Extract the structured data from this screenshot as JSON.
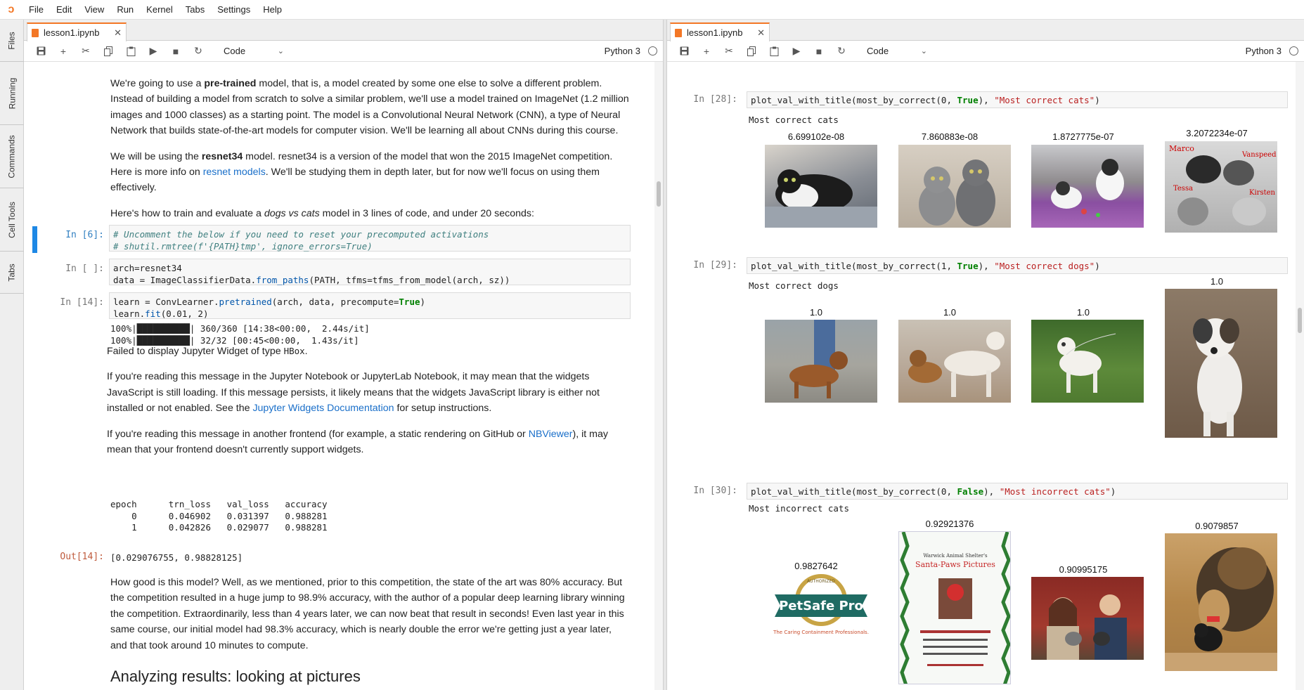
{
  "menubar": {
    "items": [
      "File",
      "Edit",
      "View",
      "Run",
      "Kernel",
      "Tabs",
      "Settings",
      "Help"
    ]
  },
  "sidebar": {
    "tabs": [
      "Files",
      "Running",
      "Commands",
      "Cell Tools",
      "Tabs"
    ]
  },
  "left": {
    "tab_title": "lesson1.ipynb",
    "cell_type": "Code",
    "kernel": "Python 3",
    "md1": {
      "p1_a": "We're going to use a ",
      "p1_b": "pre-trained",
      "p1_c": " model, that is, a model created by some one else to solve a different problem. Instead of building a model from scratch to solve a similar problem, we'll use a model trained on ImageNet (1.2 million images and 1000 classes) as a starting point. The model is a Convolutional Neural Network (CNN), a type of Neural Network that builds state-of-the-art models for computer vision. We'll be learning all about CNNs during this course.",
      "p2_a": "We will be using the ",
      "p2_b": "resnet34",
      "p2_c": " model. resnet34 is a version of the model that won the 2015 ImageNet competition. Here is more info on ",
      "p2_link": "resnet models",
      "p2_d": ". We'll be studying them in depth later, but for now we'll focus on using them effectively.",
      "p3_a": "Here's how to train and evaluate a ",
      "p3_b": "dogs vs cats",
      "p3_c": " model in 3 lines of code, and under 20 seconds:"
    },
    "cell6": {
      "prompt": "In [6]:",
      "line1": "# Uncomment the below if you need to reset your precomputed activations",
      "line2": "# shutil.rmtree(f'{PATH}tmp', ignore_errors=True)"
    },
    "cell_empty": {
      "prompt": "In [ ]:",
      "line1": "arch=resnet34",
      "line2_a": "data = ImageClassifierData.",
      "line2_fn": "from_paths",
      "line2_b": "(PATH, tfms=tfms_from_model(arch, sz))"
    },
    "cell14": {
      "prompt": "In [14]:",
      "line1_a": "learn = ConvLearner.",
      "line1_fn": "pretrained",
      "line1_b": "(arch, data, precompute=",
      "line1_kw": "True",
      "line1_c": ")",
      "line2_a": "learn.",
      "line2_fn": "fit",
      "line2_b": "(0.01, 2)",
      "progress1": "100%|██████████| 360/360 [14:38<00:00,  2.44s/it]",
      "progress2": "100%|██████████| 32/32 [00:45<00:00,  1.43s/it]",
      "widget_fail_a": "Failed to display Jupyter Widget of type ",
      "widget_fail_b": "HBox",
      "widget_fail_c": ".",
      "widget_p1_a": "If you're reading this message in the Jupyter Notebook or JupyterLab Notebook, it may mean that the widgets JavaScript is still loading. If this message persists, it likely means that the widgets JavaScript library is either not installed or not enabled. See the ",
      "widget_p1_link": "Jupyter Widgets Documentation",
      "widget_p1_b": " for setup instructions.",
      "widget_p2_a": "If you're reading this message in another frontend (for example, a static rendering on GitHub or ",
      "widget_p2_link": "NBViewer",
      "widget_p2_b": "), it may mean that your frontend doesn't currently support widgets.",
      "table": "epoch      trn_loss   val_loss   accuracy\n    0      0.046902   0.031397   0.988281\n    1      0.042826   0.029077   0.988281",
      "out_prompt": "Out[14]:",
      "out_value": "[0.029076755, 0.98828125]"
    },
    "md2": "How good is this model? Well, as we mentioned, prior to this competition, the state of the art was 80% accuracy. But the competition resulted in a huge jump to 98.9% accuracy, with the author of a popular deep learning library winning the competition. Extraordinarily, less than 4 years later, we can now beat that result in seconds! Even last year in this same course, our initial model had 98.3% accuracy, which is nearly double the error we're getting just a year later, and that took around 10 minutes to compute.",
    "heading": "Analyzing results: looking at pictures"
  },
  "right": {
    "tab_title": "lesson1.ipynb",
    "cell_type": "Code",
    "kernel": "Python 3",
    "cell28": {
      "prompt": "In [28]:",
      "code_a": "plot_val_with_title(most_by_correct(0, ",
      "code_kw": "True",
      "code_b": "), ",
      "code_str": "\"Most correct cats\"",
      "code_c": ")",
      "output_title": "Most correct cats",
      "scores": [
        "6.699102e-08",
        "7.860883e-08",
        "1.8727775e-07",
        "3.2072234e-07"
      ],
      "overlay_names": [
        "Marco",
        "Vanspeed",
        "Tessa",
        "Kirsten"
      ]
    },
    "cell29": {
      "prompt": "In [29]:",
      "code_a": "plot_val_with_title(most_by_correct(1, ",
      "code_kw": "True",
      "code_b": "), ",
      "code_str": "\"Most correct dogs\"",
      "code_c": ")",
      "output_title": "Most correct dogs",
      "scores": [
        "1.0",
        "1.0",
        "1.0",
        "1.0"
      ]
    },
    "cell30": {
      "prompt": "In [30]:",
      "code_a": "plot_val_with_title(most_by_correct(0, ",
      "code_kw": "False",
      "code_b": "), ",
      "code_str": "\"Most incorrect cats\"",
      "code_c": ")",
      "output_title": "Most incorrect cats",
      "scores": [
        "0.9827642",
        "0.92921376",
        "0.90995175",
        "0.9079857"
      ],
      "petsafe_logo": "PetSafe Pro",
      "petsafe_ring": "AUTHORIZED",
      "petsafe_tagline": "The Caring Containment Professionals.",
      "flyer_org": "Warwick Animal Shelter's",
      "flyer_title": "Santa-Paws Pictures"
    }
  },
  "colors": {
    "accent": "#f37726",
    "prompt_in": "#307fc1",
    "prompt_out": "#bf5b3d",
    "active_cell": "#1e88e5",
    "link": "#1a6fc9"
  }
}
